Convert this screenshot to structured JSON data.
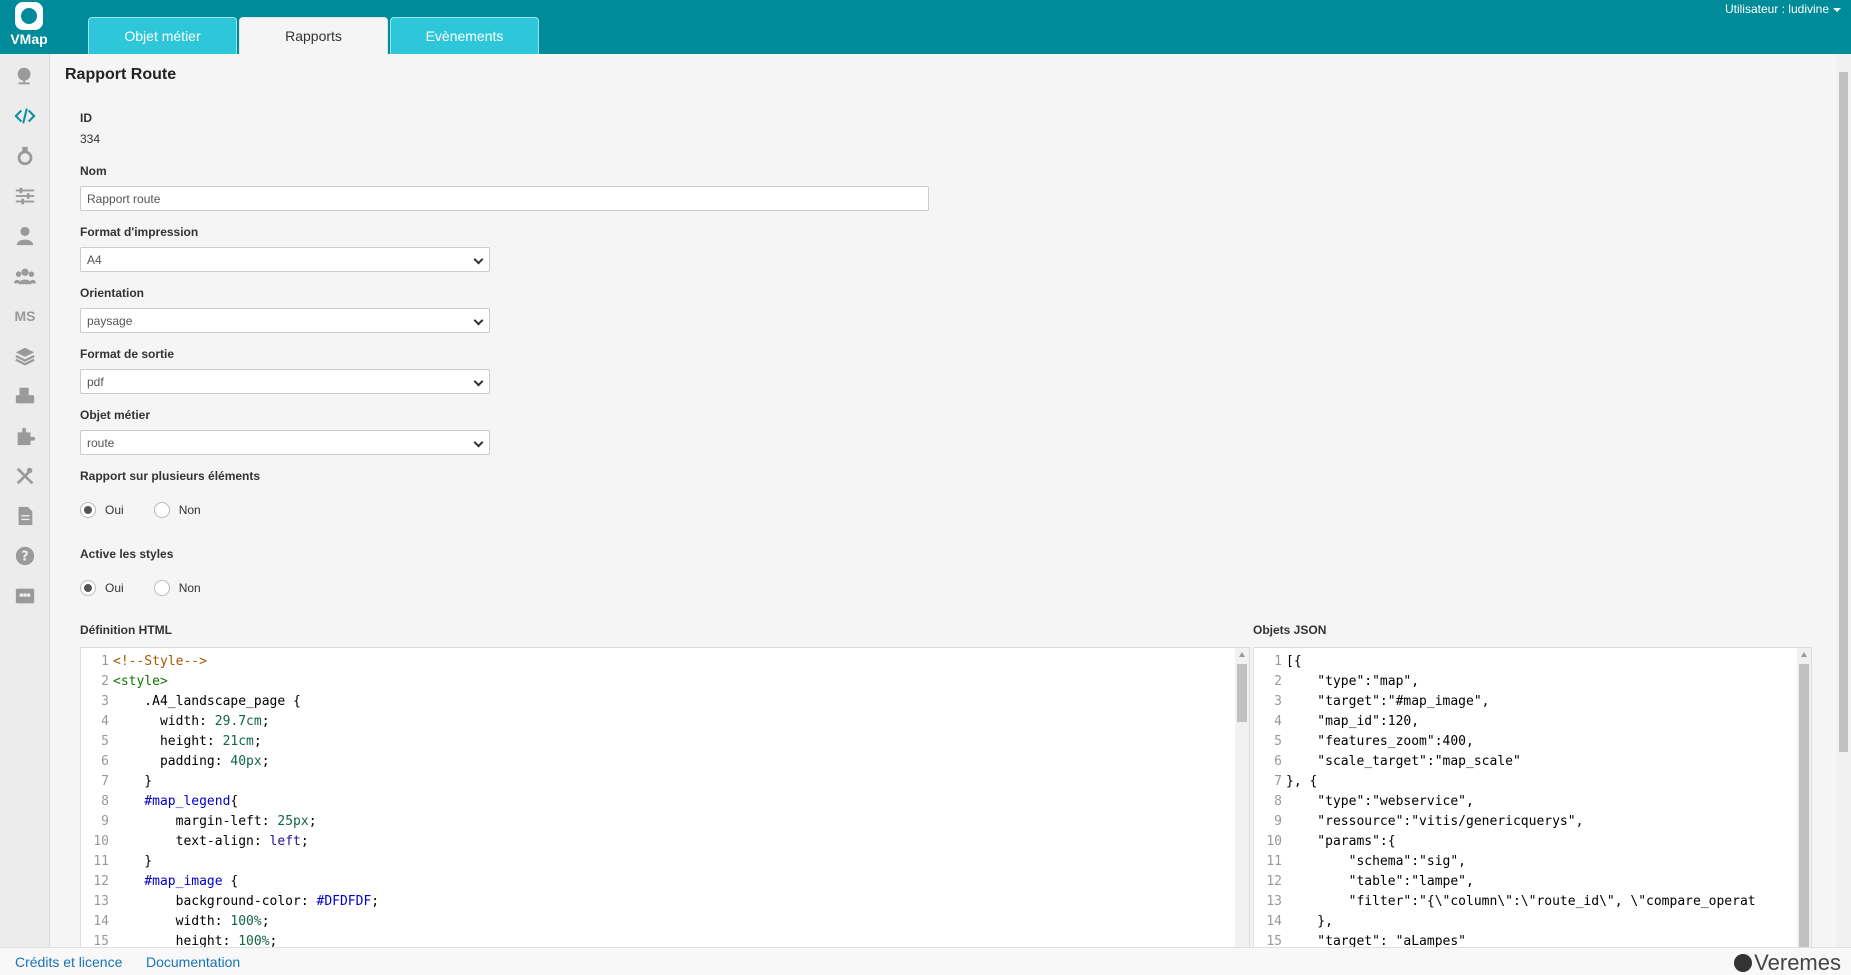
{
  "app": {
    "logo_text": "VMap"
  },
  "header": {
    "tabs": [
      {
        "label": "Objet métier",
        "active": false
      },
      {
        "label": "Rapports",
        "active": true
      },
      {
        "label": "Evènements",
        "active": false
      }
    ],
    "user_label": "Utilisateur : ludivine"
  },
  "sidebar": {
    "items": [
      {
        "icon": "globe-icon"
      },
      {
        "icon": "code-icon",
        "active": true
      },
      {
        "icon": "flask-icon"
      },
      {
        "icon": "sliders-icon"
      },
      {
        "icon": "user-icon"
      },
      {
        "icon": "users-icon"
      },
      {
        "icon": "ms-text",
        "text": "MS"
      },
      {
        "icon": "layers-icon"
      },
      {
        "icon": "printer-icon"
      },
      {
        "icon": "puzzle-icon"
      },
      {
        "icon": "tools-icon"
      },
      {
        "icon": "document-icon"
      },
      {
        "icon": "help-icon"
      },
      {
        "icon": "group-card-icon"
      }
    ]
  },
  "form": {
    "title": "Rapport Route",
    "id_label": "ID",
    "id_value": "334",
    "nom_label": "Nom",
    "nom_value": "Rapport route",
    "format_label": "Format d'impression",
    "format_value": "A4",
    "orientation_label": "Orientation",
    "orientation_value": "paysage",
    "sortie_label": "Format de sortie",
    "sortie_value": "pdf",
    "objet_label": "Objet métier",
    "objet_value": "route",
    "multi_label": "Rapport sur plusieurs éléments",
    "multi_options": {
      "yes": "Oui",
      "no": "Non"
    },
    "multi_selected": "Oui",
    "styles_label": "Active les styles",
    "styles_options": {
      "yes": "Oui",
      "no": "Non"
    },
    "styles_selected": "Oui",
    "html_label": "Définition HTML",
    "json_label": "Objets JSON"
  },
  "html_editor": {
    "lines": [
      [
        {
          "t": "<!--Style-->",
          "c": "#aa5500"
        }
      ],
      [
        {
          "t": "<style>",
          "c": "#117700"
        }
      ],
      [
        {
          "t": "    .A4_landscape_page {",
          "c": "#000000"
        }
      ],
      [
        {
          "t": "      width: ",
          "c": "#000000"
        },
        {
          "t": "29.7cm",
          "c": "#116644"
        },
        {
          "t": ";",
          "c": "#000000"
        }
      ],
      [
        {
          "t": "      height: ",
          "c": "#000000"
        },
        {
          "t": "21cm",
          "c": "#116644"
        },
        {
          "t": ";",
          "c": "#000000"
        }
      ],
      [
        {
          "t": "      padding: ",
          "c": "#000000"
        },
        {
          "t": "40px",
          "c": "#116644"
        },
        {
          "t": ";",
          "c": "#000000"
        }
      ],
      [
        {
          "t": "    }",
          "c": "#000000"
        }
      ],
      [
        {
          "t": "    #map_legend",
          "c": "#0000cc"
        },
        {
          "t": "{",
          "c": "#000000"
        }
      ],
      [
        {
          "t": "        margin-left: ",
          "c": "#000000"
        },
        {
          "t": "25px",
          "c": "#116644"
        },
        {
          "t": ";",
          "c": "#000000"
        }
      ],
      [
        {
          "t": "        text-align: ",
          "c": "#000000"
        },
        {
          "t": "left",
          "c": "#221199"
        },
        {
          "t": ";",
          "c": "#000000"
        }
      ],
      [
        {
          "t": "    }",
          "c": "#000000"
        }
      ],
      [
        {
          "t": "    #map_image",
          "c": "#0000cc"
        },
        {
          "t": " {",
          "c": "#000000"
        }
      ],
      [
        {
          "t": "        background-color: ",
          "c": "#000000"
        },
        {
          "t": "#DFDFDF",
          "c": "#0000cc"
        },
        {
          "t": ";",
          "c": "#000000"
        }
      ],
      [
        {
          "t": "        width: ",
          "c": "#000000"
        },
        {
          "t": "100%",
          "c": "#116644"
        },
        {
          "t": ";",
          "c": "#000000"
        }
      ],
      [
        {
          "t": "        height: ",
          "c": "#000000"
        },
        {
          "t": "100%",
          "c": "#116644"
        },
        {
          "t": ";",
          "c": "#000000"
        }
      ]
    ]
  },
  "json_editor": {
    "lines": [
      "[{",
      "    \"type\":\"map\",",
      "    \"target\":\"#map_image\",",
      "    \"map_id\":120,",
      "    \"features_zoom\":400,",
      "    \"scale_target\":\"map_scale\"",
      "}, {",
      "    \"type\":\"webservice\",",
      "    \"ressource\":\"vitis/genericquerys\",",
      "    \"params\":{",
      "        \"schema\":\"sig\",",
      "        \"table\":\"lampe\",",
      "        \"filter\":\"{\\\"column\\\":\\\"route_id\\\", \\\"compare_operat",
      "    },",
      "    \"target\": \"aLampes\""
    ]
  },
  "footer": {
    "credits": "Crédits et licence",
    "documentation": "Documentation",
    "brand": "Veremes"
  }
}
